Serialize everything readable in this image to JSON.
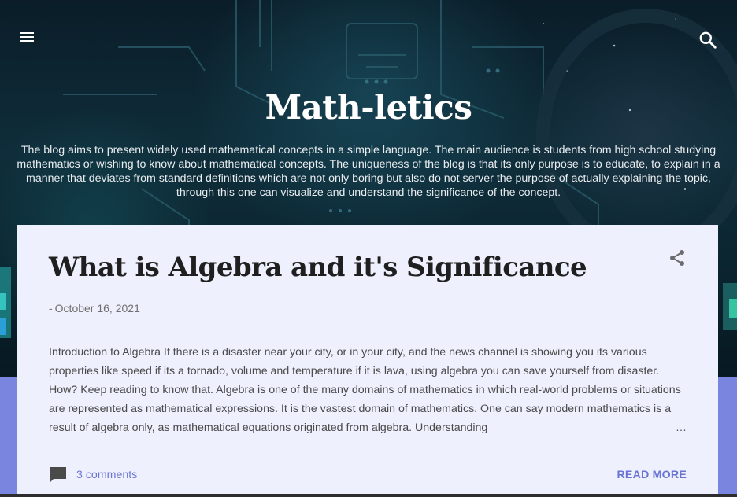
{
  "header": {
    "menu_icon": "menu-icon",
    "search_icon": "search-icon",
    "title": "Math-letics",
    "description": "The blog aims to present widely used mathematical concepts in a simple language. The main audience is students from high school studying mathematics or wishing to know about mathematical concepts. The uniqueness of the blog is that its only purpose is to educate, to explain in a manner that deviates from standard definitions which are not only boring but also do not server the purpose of actually explaining the topic, through this one can visualize and understand the significance of the concept."
  },
  "post": {
    "title": "What is Algebra and it's Significance",
    "share_icon": "share-icon",
    "date_prefix": "-",
    "date": "October 16, 2021",
    "snippet": "Introduction to Algebra If there is a disaster near your city, or in your city, and the news channel is showing you its various properties like speed if its a tornado, volume and temperature if it is lava, using algebra you can save yourself from disaster. How? Keep reading to know that. Algebra is one of the many domains of mathematics in which real-world problems or situations are represented as mathematical expressions. It is the vastest domain of mathematics. One can say modern mathematics is a result of algebra only, as mathematical equations originated from algebra. Understanding",
    "ellipsis": "…",
    "comments_icon": "comment-icon",
    "comments_label": "3 comments",
    "read_more_label": "READ MORE"
  },
  "colors": {
    "accent": "#6a74d4",
    "page_background": "#7a85df",
    "card_background": "#eef0fd",
    "title_text": "#1f1f1f"
  }
}
